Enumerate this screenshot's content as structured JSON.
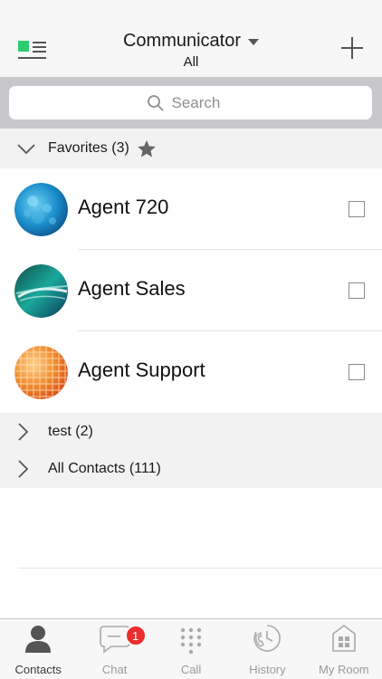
{
  "header": {
    "title": "Communicator",
    "subtitle": "All"
  },
  "search": {
    "placeholder": "Search"
  },
  "groups": [
    {
      "label": "Favorites (3)",
      "expanded": true
    },
    {
      "label": "test (2)",
      "expanded": false
    },
    {
      "label": "All Contacts (111)",
      "expanded": false
    }
  ],
  "contacts": [
    {
      "name": "Agent 720",
      "selected": false
    },
    {
      "name": "Agent Sales",
      "selected": false
    },
    {
      "name": "Agent Support",
      "selected": false
    }
  ],
  "tabs": [
    {
      "label": "Contacts",
      "icon": "person-icon",
      "active": true
    },
    {
      "label": "Chat",
      "icon": "chat-bubble-icon",
      "badge": "1"
    },
    {
      "label": "Call",
      "icon": "dialpad-icon"
    },
    {
      "label": "History",
      "icon": "clock-phone-icon"
    },
    {
      "label": "My Room",
      "icon": "room-icon"
    }
  ],
  "colors": {
    "accent_green": "#2ecc71",
    "badge_red": "#ea2d2d",
    "group_bg": "#f2f2f2",
    "search_bar_bg": "#c8c8cc"
  }
}
